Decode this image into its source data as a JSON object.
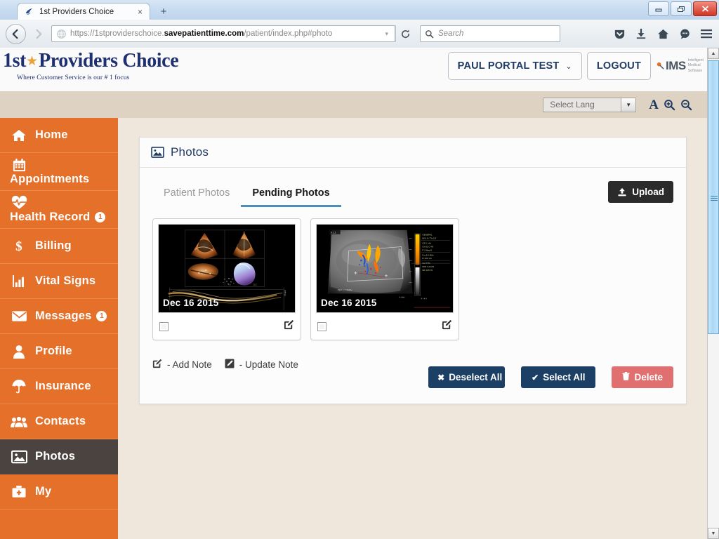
{
  "browser": {
    "tab_title": "1st Providers Choice",
    "tab_close": "×",
    "new_tab": "+",
    "url_prefix": "https://1stproviderschoice.",
    "url_domain": "savepatienttime.com",
    "url_suffix": "/patient/index.php#photo",
    "search_placeholder": "Search",
    "window_minimize": "–",
    "window_maximize": "❐",
    "window_close": "✕"
  },
  "header": {
    "logo_first": "1st",
    "logo_star": "★",
    "logo_rest": "Providers Choice",
    "logo_tagline": "Where Customer Service is our # 1 focus",
    "user_button": "PAUL PORTAL TEST",
    "user_caret": "⌄",
    "logout_button": "LOGOUT",
    "ims_text": "IMS",
    "ims_sub_line1": "Intelligent",
    "ims_sub_line2": "Medical",
    "ims_sub_line3": "Software"
  },
  "langbar": {
    "select_label": "Select Lang",
    "dropdown_arrow": "▼",
    "font_letter": "A",
    "zoom_in": "zoom-in-icon",
    "zoom_out": "zoom-out-icon"
  },
  "sidebar": {
    "collapse_arrow": "«",
    "items": [
      {
        "label": "Home",
        "icon": "home-icon",
        "badge": null,
        "active": false
      },
      {
        "label": "Appointments",
        "icon": "calendar-icon",
        "badge": null,
        "active": false
      },
      {
        "label": "Health Record",
        "icon": "heartbeat-icon",
        "badge": "1",
        "active": false
      },
      {
        "label": "Billing",
        "icon": "dollar-icon",
        "badge": null,
        "active": false
      },
      {
        "label": "Vital Signs",
        "icon": "bar-chart-icon",
        "badge": null,
        "active": false
      },
      {
        "label": "Messages",
        "icon": "envelope-icon",
        "badge": "1",
        "active": false
      },
      {
        "label": "Profile",
        "icon": "user-icon",
        "badge": null,
        "active": false
      },
      {
        "label": "Insurance",
        "icon": "umbrella-icon",
        "badge": null,
        "active": false
      },
      {
        "label": "Contacts",
        "icon": "group-icon",
        "badge": null,
        "active": false
      },
      {
        "label": "Photos",
        "icon": "image-icon",
        "badge": null,
        "active": true
      },
      {
        "label": "My",
        "icon": "medkit-icon",
        "badge": null,
        "active": false
      }
    ]
  },
  "panel": {
    "title": "Photos",
    "title_icon": "image-icon",
    "tabs": [
      {
        "label": "Patient Photos",
        "active": false
      },
      {
        "label": "Pending Photos",
        "active": true
      }
    ],
    "upload_button": "Upload",
    "upload_icon": "upload-icon",
    "photos": [
      {
        "date": "Dec 16 2015",
        "kind": "echocardiogram-quad",
        "edit_icon": "add-note-icon",
        "checkbox_checked": false
      },
      {
        "date": "Dec 16 2015",
        "kind": "doppler-ultrasound",
        "edit_icon": "add-note-icon",
        "checkbox_checked": false
      }
    ],
    "legend": [
      {
        "icon": "add-note-icon",
        "text": "- Add Note"
      },
      {
        "icon": "update-note-icon",
        "text": "- Update Note"
      }
    ],
    "actions": [
      {
        "label": "Deselect All",
        "icon": "✖",
        "style": "navy"
      },
      {
        "label": "Select All",
        "icon": "✔",
        "style": "navy"
      },
      {
        "label": "Delete",
        "icon": "trash-icon",
        "style": "red"
      }
    ]
  },
  "colors": {
    "sidebar_orange": "#e4702a",
    "sidebar_active": "#4a4340",
    "accent_blue": "#4d8fb5",
    "navy_button": "#1c3f66",
    "delete_red": "#e07070",
    "page_bg": "#efe7dc",
    "lang_strip": "#ded2c2"
  },
  "scrollbar": {
    "up": "▲",
    "down": "▼"
  }
}
